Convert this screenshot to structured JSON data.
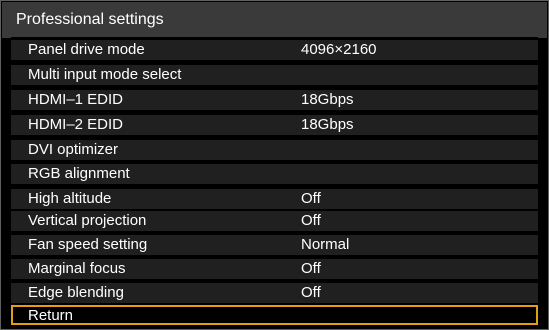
{
  "title": "Professional settings",
  "colors": {
    "background": "#000000",
    "title_bar": "#3a3a3a",
    "row": "#202020",
    "text": "#ffffff",
    "selection_border": "#e79c16"
  },
  "menu": {
    "items": [
      {
        "label": "Panel drive mode",
        "value": "4096×2160"
      },
      {
        "label": "Multi input mode select",
        "value": ""
      },
      {
        "label": "HDMI–1 EDID",
        "value": "18Gbps"
      },
      {
        "label": "HDMI–2 EDID",
        "value": "18Gbps"
      },
      {
        "label": "DVI optimizer",
        "value": ""
      },
      {
        "label": "RGB alignment",
        "value": ""
      },
      {
        "label": "High altitude",
        "value": "Off"
      },
      {
        "label": "Vertical projection",
        "value": "Off"
      },
      {
        "label": "Fan speed setting",
        "value": "Normal"
      },
      {
        "label": "Marginal focus",
        "value": "Off"
      },
      {
        "label": "Edge blending",
        "value": "Off"
      }
    ],
    "return_label": "Return",
    "selected": "Return"
  }
}
